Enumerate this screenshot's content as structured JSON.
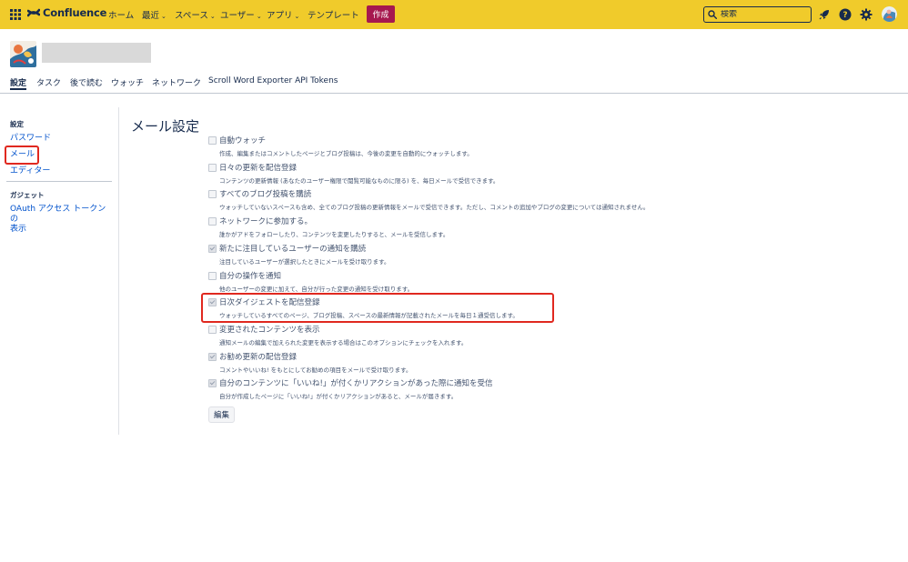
{
  "topbar": {
    "brand": "Confluence",
    "nav": [
      {
        "label": "ホーム",
        "caret": ""
      },
      {
        "label": "最近",
        "caret": "⌄"
      },
      {
        "label": "スペース",
        "caret": "⌄"
      },
      {
        "label": "ユーザー",
        "caret": "⌄"
      },
      {
        "label": "アプリ",
        "caret": "⌄"
      },
      {
        "label": "テンプレート",
        "caret": ""
      }
    ],
    "create_label": "作成",
    "search_placeholder": "検索",
    "icons": [
      "apps-grid-icon",
      "confluence-logo-icon",
      "search-icon",
      "notification-rocket-icon",
      "help-icon",
      "settings-gear-icon",
      "user-avatar"
    ],
    "colors": {
      "bar": "#f0cb2b",
      "create": "#a6184f"
    }
  },
  "profile": {
    "tabs": [
      "設定",
      "タスク",
      "後で読む",
      "ウォッチ",
      "ネットワーク",
      "Scroll Word Exporter API Tokens"
    ]
  },
  "sidebar": {
    "section_settings": "設定",
    "links": [
      "パスワード",
      "メール",
      "エディター"
    ],
    "section_gadgets": "ガジェット",
    "gadget_link": "OAuth アクセス トークンの表示",
    "gadget_link_line1": "OAuth アクセス トークンの",
    "gadget_link_line2": "表示"
  },
  "main": {
    "title": "メール設定",
    "options": [
      {
        "label": "自動ウォッチ",
        "desc": "作成、編集またはコメントしたページとブログ投稿は、今後の変更を自動的にウォッチします。",
        "checked": false
      },
      {
        "label": "日々の更新を配信登録",
        "desc": "コンテンツの更新情報 (あなたのユーザー権限で閲覧可能なものに限る) を、毎日メールで受信できます。",
        "checked": false
      },
      {
        "label": "すべてのブログ投稿を購読",
        "desc": "ウォッチしていないスペースも含め、全てのブログ投稿の更新情報をメールで受信できます。ただし、コメントの追加やブログの変更については通知されません。",
        "checked": false
      },
      {
        "label": "ネットワークに参加する。",
        "desc": "誰かがアドをフォローしたり、コンテンツを変更したりすると、メールを受信します。",
        "checked": false
      },
      {
        "label": "新たに注目しているユーザーの通知を購読",
        "desc": "注目しているユーザーが選択したときにメールを受け取ります。",
        "checked": true
      },
      {
        "label": "自分の操作を通知",
        "desc": "他のユーザーの変更に加えて、自分が行った変更の通知を受け取ります。",
        "checked": false
      },
      {
        "label": "日次ダイジェストを配信登録",
        "desc": "ウォッチしているすべてのページ、ブログ投稿、スペースの最新情報が記載されたメールを毎日１通受信します。",
        "checked": true
      },
      {
        "label": "変更されたコンテンツを表示",
        "desc": "通知メールの編集で加えられた変更を表示する場合はこのオプションにチェックを入れます。",
        "checked": false
      },
      {
        "label": "お勧め更新の配信登録",
        "desc": "コメントやいいね! をもとにしてお勧めの項目をメールで受け取ります。",
        "checked": true
      },
      {
        "label": "自分のコンテンツに「いいね!」が付くかリアクションがあった際に通知を受信",
        "desc": "自分が作成したページに「いいね!」が付くかリアクションがあると、メールが届きます。",
        "checked": true
      }
    ],
    "edit_button": "編集"
  },
  "highlight_color": "#e0281f"
}
